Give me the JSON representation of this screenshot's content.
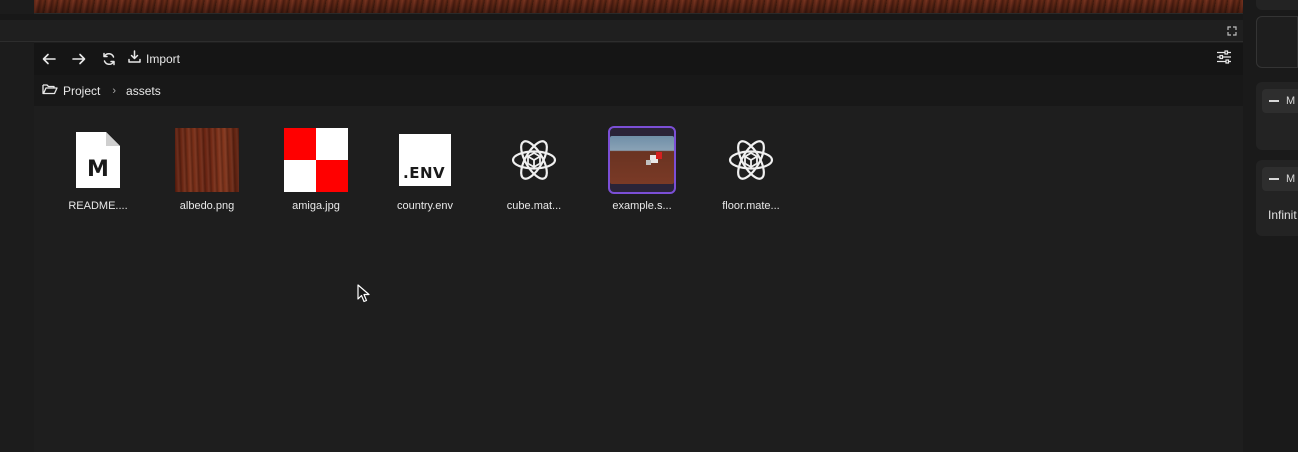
{
  "toolbar": {
    "back_icon": "arrow-left-icon",
    "forward_icon": "arrow-right-icon",
    "refresh_icon": "refresh-icon",
    "import_icon": "download-icon",
    "import_label": "Import",
    "filter_icon": "sliders-icon"
  },
  "breadcrumb": {
    "root_icon": "folder-open-icon",
    "root_label": "Project",
    "separator": "›",
    "current_label": "assets"
  },
  "files": [
    {
      "label": "README....",
      "kind": "markdown",
      "doc_glyph": "M"
    },
    {
      "label": "albedo.png",
      "kind": "texture-wood"
    },
    {
      "label": "amiga.jpg",
      "kind": "texture-checker",
      "colors": [
        "#ff0000",
        "#ffffff"
      ]
    },
    {
      "label": "country.env",
      "kind": "env",
      "env_text": ".ENV"
    },
    {
      "label": "cube.mat...",
      "kind": "material"
    },
    {
      "label": "example.s...",
      "kind": "scene",
      "selected": true
    },
    {
      "label": "floor.mate...",
      "kind": "material"
    }
  ],
  "right_panel": {
    "sections": [
      {
        "title": "M"
      },
      {
        "title": "M",
        "value": "Infinit"
      }
    ]
  },
  "colors": {
    "background": "#1e1e1e",
    "toolbar": "#151515",
    "selection_border": "#7b4fd6"
  }
}
